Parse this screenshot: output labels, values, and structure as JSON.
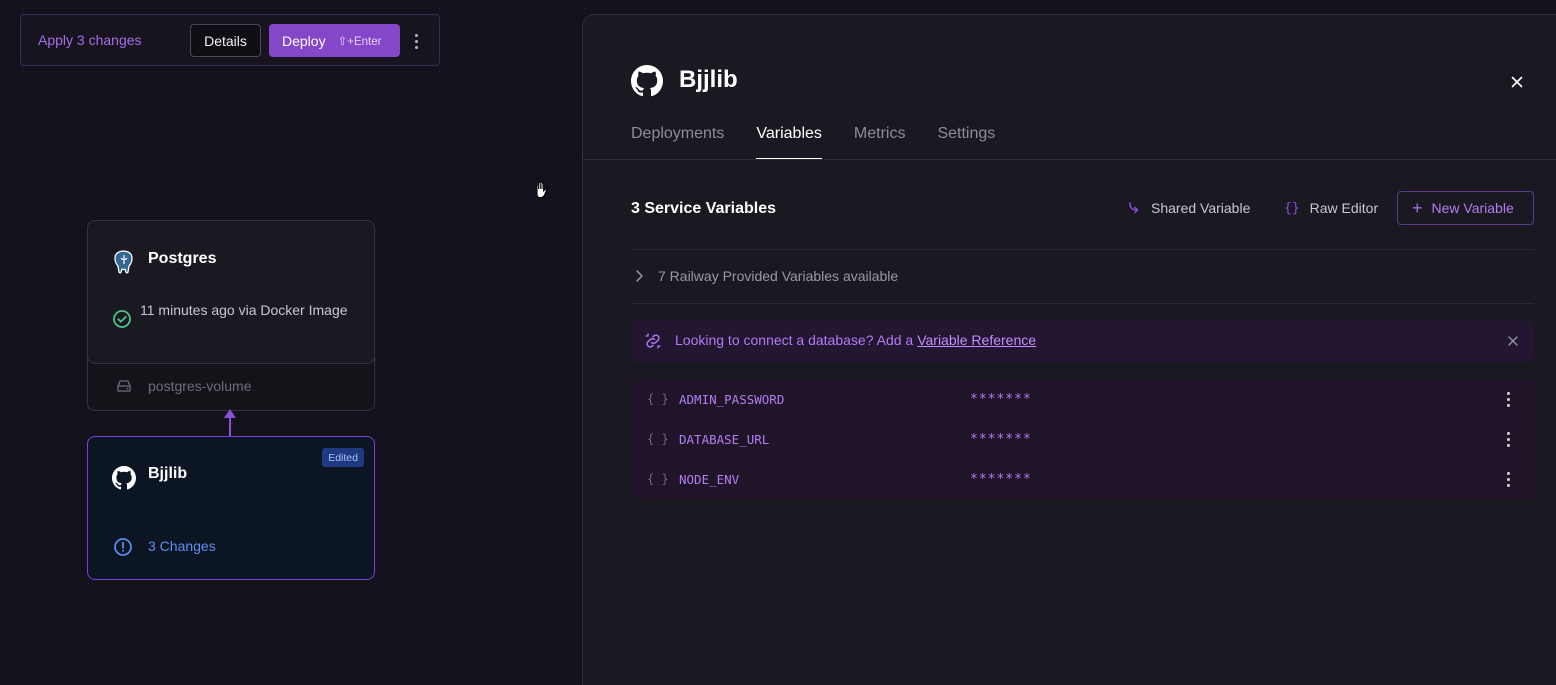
{
  "changes_bar": {
    "apply_label": "Apply 3 changes",
    "details_label": "Details",
    "deploy_label": "Deploy",
    "deploy_shortcut": "⇧+Enter",
    "menu_icon": "more-vertical-icon"
  },
  "canvas": {
    "postgres": {
      "title": "Postgres",
      "icon": "postgres-elephant-icon",
      "status": "11 minutes ago via Docker Image",
      "status_icon": "check-circle-icon",
      "volume_label": "postgres-volume",
      "volume_icon": "volume-icon"
    },
    "bjjlib": {
      "title": "Bjjlib",
      "icon": "github-icon",
      "badge": "Edited",
      "changes_label": "3 Changes",
      "changes_icon": "alert-circle-icon"
    }
  },
  "panel": {
    "title": "Bjjlib",
    "icon": "github-icon",
    "tabs": [
      {
        "label": "Deployments"
      },
      {
        "label": "Variables"
      },
      {
        "label": "Metrics"
      },
      {
        "label": "Settings"
      }
    ],
    "active_tab": "Variables",
    "section_title": "3 Service Variables",
    "shared_variable_label": "Shared Variable",
    "raw_editor_label": "Raw Editor",
    "new_variable_label": "New Variable",
    "provided_label": "7 Railway Provided Variables available",
    "banner": {
      "text": "Looking to connect a database? Add a",
      "link": "Variable Reference"
    },
    "variables": [
      {
        "name": "ADMIN_PASSWORD",
        "value": "*******"
      },
      {
        "name": "DATABASE_URL",
        "value": "*******"
      },
      {
        "name": "NODE_ENV",
        "value": "*******"
      }
    ]
  },
  "colors": {
    "accent": "#8547c9",
    "accent_text": "#b07ef0",
    "edited_badge": "#1f3a82",
    "changes_blue": "#5f8ff0",
    "status_green": "#4cc38a",
    "background": "#13111c"
  }
}
